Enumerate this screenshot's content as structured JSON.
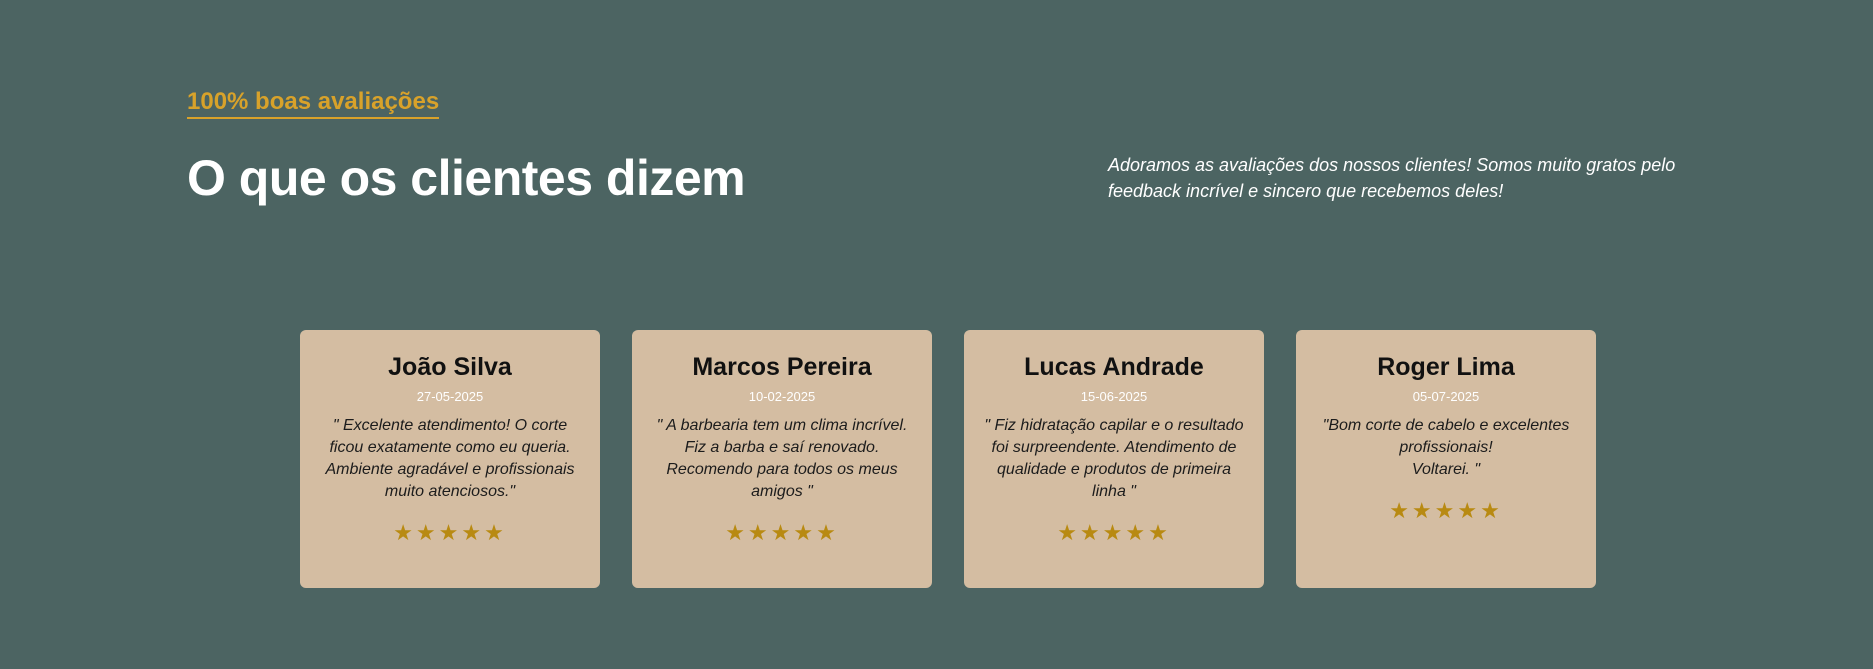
{
  "section": {
    "eyebrow": "100% boas avaliações",
    "title": "O que os clientes dizem",
    "intro": "Adoramos as avaliações dos nossos clientes! Somos muito gratos pelo feedback incrível e sincero que recebemos deles!"
  },
  "colors": {
    "background": "#4c6462",
    "accent": "#d8a22a",
    "card": "#d4bda2",
    "star": "#b88a12"
  },
  "reviews": [
    {
      "name": "João Silva",
      "date": "27-05-2025",
      "text": "\" Excelente atendimento! O corte ficou exatamente como eu queria. Ambiente agradável e profissionais muito atenciosos.\"",
      "stars": "★★★★★",
      "rating": 5
    },
    {
      "name": "Marcos Pereira",
      "date": "10-02-2025",
      "text": "\" A barbearia tem um clima incrível. Fiz a barba e saí renovado. Recomendo para todos os meus amigos \"",
      "stars": "★★★★★",
      "rating": 5
    },
    {
      "name": "Lucas Andrade",
      "date": "15-06-2025",
      "text": "\" Fiz hidratação capilar e o resultado foi surpreendente. Atendimento de qualidade e produtos de primeira linha \"",
      "stars": "★★★★★",
      "rating": 5
    },
    {
      "name": "Roger Lima",
      "date": "05-07-2025",
      "text": "\"Bom corte de cabelo e excelentes profissionais!\nVoltarei. \"",
      "stars": "★★★★★",
      "rating": 5
    }
  ]
}
